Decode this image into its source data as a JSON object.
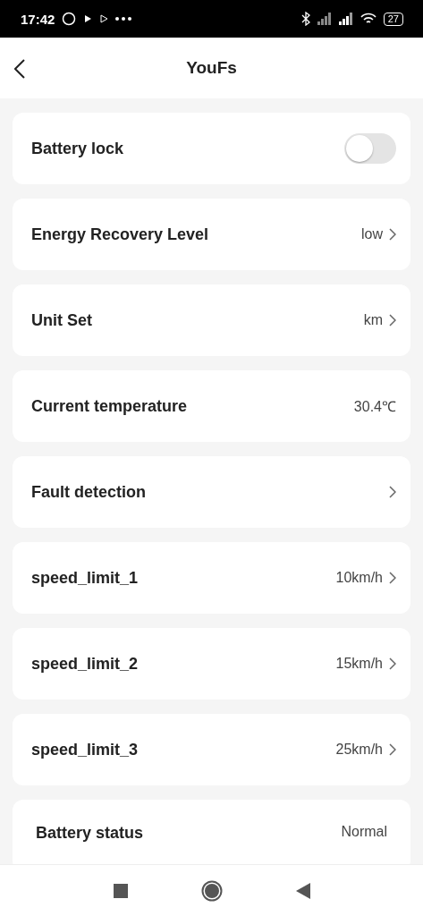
{
  "status_bar": {
    "time": "17:42",
    "battery": "27"
  },
  "header": {
    "title": "YouFs"
  },
  "items": [
    {
      "kind": "toggle",
      "label": "Battery lock",
      "on": false
    },
    {
      "kind": "link",
      "label": "Energy Recovery Level",
      "value": "low"
    },
    {
      "kind": "link",
      "label": "Unit Set",
      "value": "km"
    },
    {
      "kind": "value",
      "label": "Current temperature",
      "value": "30.4℃"
    },
    {
      "kind": "link",
      "label": "Fault detection"
    },
    {
      "kind": "link",
      "label": "speed_limit_1",
      "value": "10km/h"
    },
    {
      "kind": "link",
      "label": "speed_limit_2",
      "value": "15km/h"
    },
    {
      "kind": "link",
      "label": "speed_limit_3",
      "value": "25km/h"
    },
    {
      "kind": "value",
      "label": "Battery status",
      "value": "Normal"
    }
  ]
}
